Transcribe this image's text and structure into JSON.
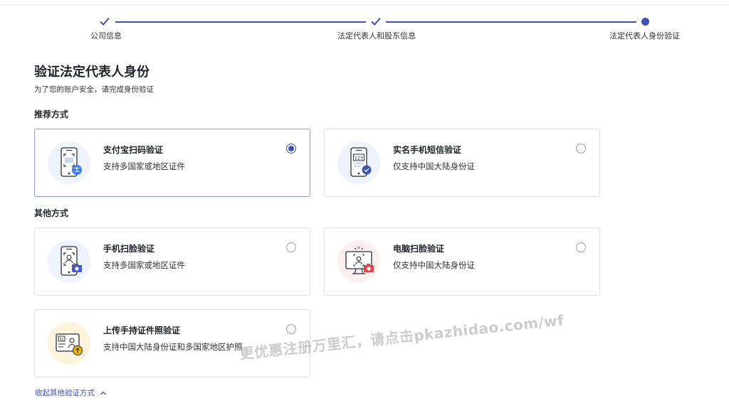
{
  "stepper": {
    "steps": [
      {
        "label": "公司信息",
        "status": "done"
      },
      {
        "label": "法定代表人和股东信息",
        "status": "done"
      },
      {
        "label": "法定代表人身份验证",
        "status": "current"
      }
    ],
    "accent_color": "#3f51b5"
  },
  "page": {
    "title": "验证法定代表人身份",
    "subtitle": "为了您的账户安全，请完成身份验证"
  },
  "sections": {
    "recommended": "推荐方式",
    "other": "其他方式"
  },
  "options": [
    {
      "title": "支付宝扫码验证",
      "desc": "支持多国家或地区证件",
      "icon": "alipay-scan-phone-icon",
      "selected": true
    },
    {
      "title": "实名手机短信验证",
      "desc": "仅支持中国大陆身份证",
      "icon": "sms-phone-icon",
      "selected": false
    },
    {
      "title": "手机扫脸验证",
      "desc": "支持多国家或地区证件",
      "icon": "phone-face-scan-icon",
      "selected": false
    },
    {
      "title": "电脑扫脸验证",
      "desc": "仅支持中国大陆身份证",
      "icon": "computer-face-scan-icon",
      "selected": false
    },
    {
      "title": "上传手持证件照验证",
      "desc": "支持中国大陆身份证和多国家地区护照",
      "icon": "upload-id-photo-icon",
      "selected": false
    }
  ],
  "collapse_link": "收起其他验证方式",
  "watermark": "更优惠注册万里汇，请点击pkazhidao.com/wf"
}
